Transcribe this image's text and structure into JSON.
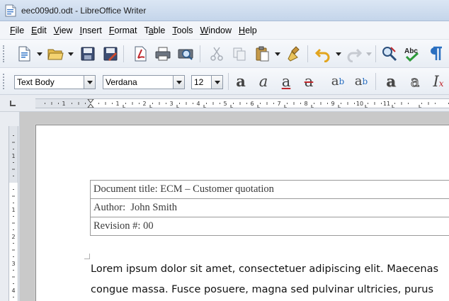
{
  "window": {
    "title": "eec009d0.odt - LibreOffice Writer"
  },
  "menu": {
    "items": [
      {
        "accel": "F",
        "rest": "ile"
      },
      {
        "accel": "E",
        "rest": "dit"
      },
      {
        "accel": "V",
        "rest": "iew"
      },
      {
        "accel": "I",
        "rest": "nsert"
      },
      {
        "accel": "F",
        "rest": "ormat",
        "prefix": ""
      },
      {
        "prefix": "T",
        "accel": "a",
        "rest": "ble"
      },
      {
        "accel": "T",
        "rest": "ools"
      },
      {
        "accel": "W",
        "rest": "indow"
      },
      {
        "accel": "H",
        "rest": "elp"
      }
    ]
  },
  "formatting": {
    "paragraph_style": "Text Body",
    "font_name": "Verdana",
    "font_size": "12"
  },
  "ruler": {
    "h_ticks": [
      "1",
      "1",
      "2",
      "3",
      "4",
      "5",
      "6",
      "7",
      "8",
      "9",
      "10",
      "11"
    ],
    "v_ticks": [
      "1",
      "1",
      "2",
      "3",
      "4"
    ]
  },
  "document": {
    "table": [
      "Document title: ECM – Customer quotation",
      "Author:  John Smith",
      "Revision #: 00"
    ],
    "body_lines": [
      "Lorem ipsum dolor sit amet, consectetuer adipiscing elit. Maecenas",
      "congue massa. Fusce posuere, magna sed pulvinar ultricies, purus"
    ]
  },
  "colors": {
    "titlebar": "#c4d5ea",
    "accent_red": "#c0282d",
    "accent_blue": "#2a6fc0"
  }
}
